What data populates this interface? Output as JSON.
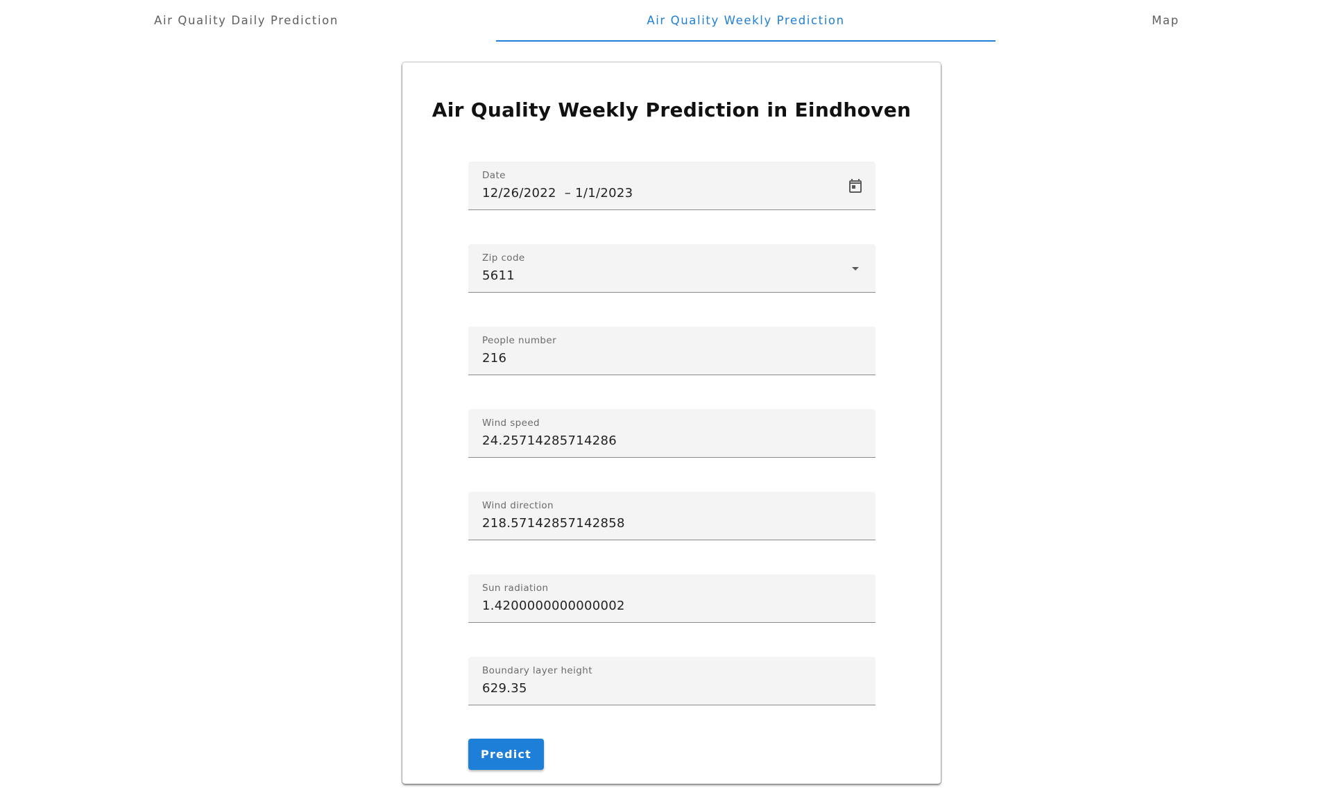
{
  "tabs": [
    {
      "label": "Air Quality Daily Prediction",
      "active": false
    },
    {
      "label": "Air Quality Weekly Prediction",
      "active": true
    },
    {
      "label": "Map",
      "active": false
    }
  ],
  "accent_color": "#1e7fd8",
  "form": {
    "title": "Air Quality Weekly Prediction in Eindhoven",
    "date": {
      "label": "Date",
      "value": "12/26/2022  – 1/1/2023",
      "icon": "calendar-icon"
    },
    "zip_code": {
      "label": "Zip code",
      "value": "5611",
      "icon": "dropdown-arrow-icon"
    },
    "people_number": {
      "label": "People number",
      "value": "216"
    },
    "wind_speed": {
      "label": "Wind speed",
      "value": "24.25714285714286"
    },
    "wind_direction": {
      "label": "Wind direction",
      "value": "218.57142857142858"
    },
    "sun_radiation": {
      "label": "Sun radiation",
      "value": "1.4200000000000002"
    },
    "boundary_layer_height": {
      "label": "Boundary layer height",
      "value": "629.35"
    },
    "predict_label": "Predict"
  }
}
